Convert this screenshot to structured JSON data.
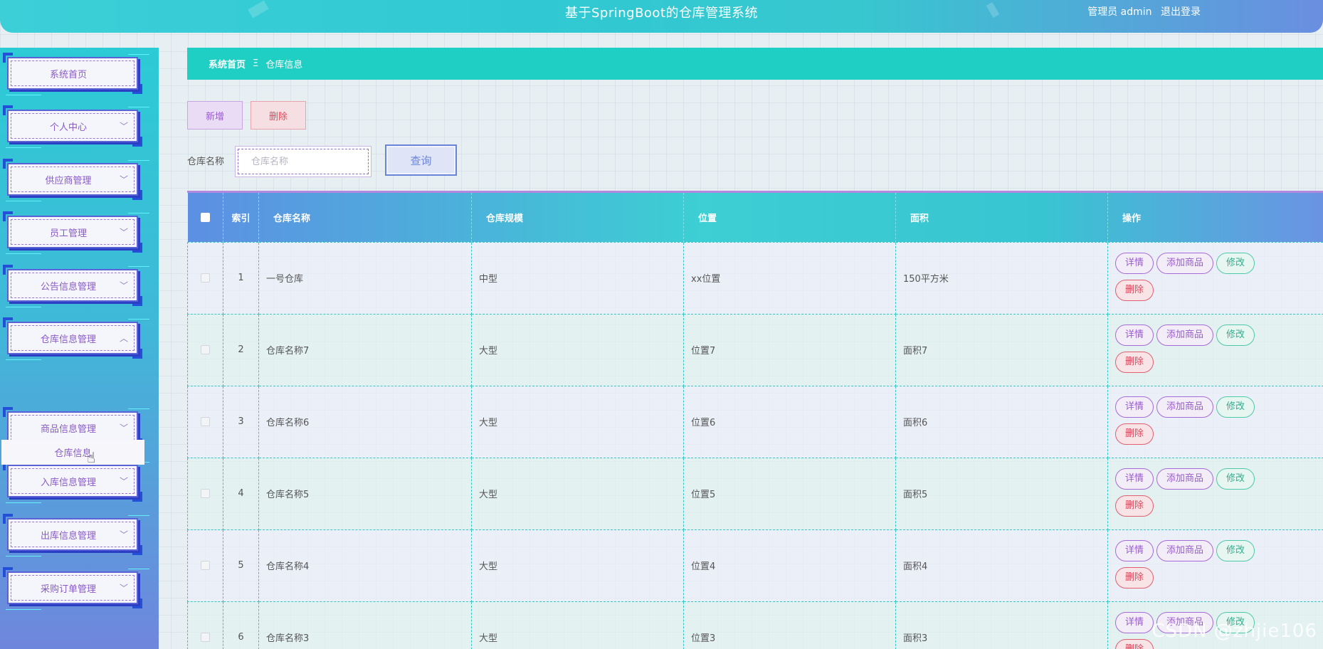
{
  "header": {
    "title": "基于SpringBoot的仓库管理系统",
    "user_label": "管理员 admin",
    "logout_label": "退出登录"
  },
  "sidebar": {
    "items": [
      {
        "label": "系统首页",
        "has_arrow": false
      },
      {
        "label": "个人中心",
        "has_arrow": true,
        "arrow": "﹀"
      },
      {
        "label": "供应商管理",
        "has_arrow": true,
        "arrow": "﹀"
      },
      {
        "label": "员工管理",
        "has_arrow": true,
        "arrow": "﹀"
      },
      {
        "label": "公告信息管理",
        "has_arrow": true,
        "arrow": "﹀"
      },
      {
        "label": "仓库信息管理",
        "has_arrow": true,
        "arrow": "︿"
      },
      {
        "label": "商品信息管理",
        "has_arrow": true,
        "arrow": "﹀"
      },
      {
        "label": "入库信息管理",
        "has_arrow": true,
        "arrow": "﹀"
      },
      {
        "label": "出库信息管理",
        "has_arrow": true,
        "arrow": "﹀"
      },
      {
        "label": "采购订单管理",
        "has_arrow": true,
        "arrow": "﹀"
      }
    ],
    "submenu": {
      "label": "仓库信息"
    }
  },
  "breadcrumb": {
    "home": "系统首页",
    "separator": "Ξ",
    "current": "仓库信息"
  },
  "toolbar": {
    "add_label": "新增",
    "delete_label": "删除"
  },
  "search": {
    "label": "仓库名称",
    "placeholder": "仓库名称",
    "value": "",
    "query_label": "查询"
  },
  "table": {
    "headers": {
      "index": "索引",
      "name": "仓库名称",
      "scale": "仓库规模",
      "location": "位置",
      "area": "面积",
      "actions": "操作"
    },
    "rows": [
      {
        "index": "1",
        "name": "一号仓库",
        "scale": "中型",
        "location": "xx位置",
        "area": "150平方米"
      },
      {
        "index": "2",
        "name": "仓库名称7",
        "scale": "大型",
        "location": "位置7",
        "area": "面积7"
      },
      {
        "index": "3",
        "name": "仓库名称6",
        "scale": "大型",
        "location": "位置6",
        "area": "面积6"
      },
      {
        "index": "4",
        "name": "仓库名称5",
        "scale": "大型",
        "location": "位置5",
        "area": "面积5"
      },
      {
        "index": "5",
        "name": "仓库名称4",
        "scale": "大型",
        "location": "位置4",
        "area": "面积4"
      },
      {
        "index": "6",
        "name": "仓库名称3",
        "scale": "大型",
        "location": "位置3",
        "area": "面积3"
      }
    ],
    "actions": {
      "detail": "详情",
      "add_goods": "添加商品",
      "edit": "修改",
      "delete": "删除"
    }
  },
  "watermark": "CSDN @zhjie106",
  "colors": {
    "header_start": "#3ccfd8",
    "breadcrumb_bg": "#20cfc4",
    "accent_purple": "#9a5bcf",
    "danger": "#d94a5d",
    "edit_green": "#2fae8d"
  }
}
